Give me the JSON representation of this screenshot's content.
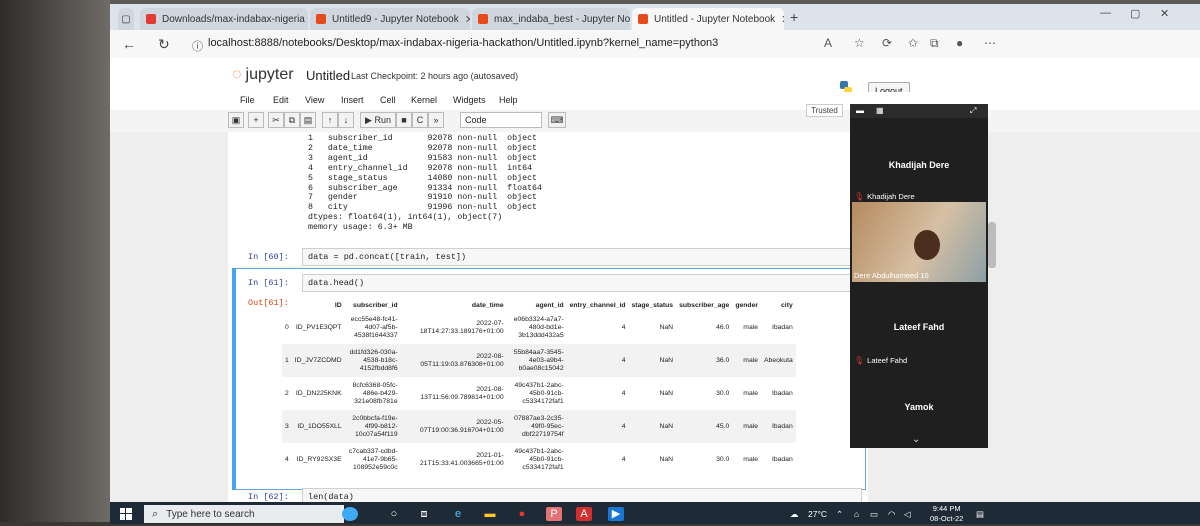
{
  "browser": {
    "tabs": [
      {
        "label": "Downloads/max-indabax-nigeria",
        "color": "#e53935"
      },
      {
        "label": "Untitled9 - Jupyter Notebook",
        "color": "#e64a19"
      },
      {
        "label": "max_indaba_best - Jupyter Note",
        "color": "#e64a19"
      },
      {
        "label": "Untitled - Jupyter Notebook",
        "color": "#e64a19"
      }
    ],
    "new_tab": "+",
    "url": "localhost:8888/notebooks/Desktop/max-indabax-nigeria-hackathon/Untitled.ipynb?kernel_name=python3"
  },
  "jupyter": {
    "logo_text": "jupyter",
    "notebook_name": "Untitled",
    "checkpoint": "Last Checkpoint: 2 hours ago  (autosaved)",
    "logout": "Logout",
    "trusted": "Trusted",
    "menu": [
      "File",
      "Edit",
      "View",
      "Insert",
      "Cell",
      "Kernel",
      "Widgets",
      "Help"
    ],
    "run_label": "Run",
    "cell_type": "Code"
  },
  "notebook": {
    "info_text": "1   subscriber_id       92078 non-null  object\n2   date_time           92078 non-null  object\n3   agent_id            91583 non-null  object\n4   entry_channel_id    92078 non-null  int64\n5   stage_status        14080 non-null  object\n6   subscriber_age      91334 non-null  float64\n7   gender              91910 non-null  object\n8   city                91996 non-null  object\ndtypes: float64(1), int64(1), object(7)\nmemory usage: 6.3+ MB",
    "cell60_prompt": "In [60]:",
    "cell60_code": "data = pd.concat([train, test])",
    "cell61_prompt": "In [61]:",
    "cell61_code": "data.head()",
    "out61_prompt": "Out[61]:",
    "cell62_prompt": "In [62]:",
    "cell62_code": "len(data)",
    "table": {
      "columns": [
        "",
        "ID",
        "subscriber_id",
        "date_time",
        "agent_id",
        "entry_channel_id",
        "stage_status",
        "subscriber_age",
        "gender",
        "city"
      ],
      "rows": [
        [
          "0",
          "ID_PV1E3QPT",
          "ecc55e48-fc41-4d07-af5b-4538f1644337",
          "2022-07-18T14:27:33.189176+01:00",
          "e06b3324-a7a7-480d-bd1e-3b13ddd432a5",
          "4",
          "NaN",
          "46.0",
          "male",
          "Ibadan"
        ],
        [
          "1",
          "ID_JV7ZCDMD",
          "dd1fd326-030a-4538-b18c-4152fbdd8f6",
          "2022-08-05T11:19:03.876308+01:00",
          "55b84aa7-3545-4e03-a9b4-b0ae08c15042",
          "4",
          "NaN",
          "36.0",
          "male",
          "Abeokuta"
        ],
        [
          "2",
          "ID_DN225KNK",
          "8cfc6368-05fc-486e-b429-321e08fb781e",
          "2021-08-13T11:56:09.789814+01:00",
          "49c437b1-2abc-45b0-91cb-c5334172faf1",
          "4",
          "NaN",
          "30.0",
          "male",
          "Ibadan"
        ],
        [
          "3",
          "ID_1DO55XLL",
          "2c0bbcfa-f19e-4f99-b812-10c07a54f119",
          "2022-05-07T19:00:36.916704+01:00",
          "07887ae3-2c35-49f0-95ec-dbf22719754f",
          "4",
          "NaN",
          "45.0",
          "male",
          "Ibadan"
        ],
        [
          "4",
          "ID_RY92SX3E",
          "c7cab337-cdbd-41e7-9b65-108952e59c0c",
          "2021-01-21T15:33:41.003665+01:00",
          "49c437b1-2abc-45b0-91cb-c5334172faf1",
          "4",
          "NaN",
          "30.0",
          "male",
          "Ibadan"
        ]
      ]
    }
  },
  "teams": {
    "participant1_name": "Khadijah Dere",
    "participant1_label": "Khadijah Dere",
    "video_label": "Dere Abdulhameed 10",
    "participant2_name": "Lateef Fahd",
    "participant2_label": "Lateef Fahd",
    "participant3_name": "Yamok"
  },
  "taskbar": {
    "search_placeholder": "Type here to search",
    "weather": "27°C",
    "time": "9:44 PM",
    "date": "08-Oct-22"
  }
}
